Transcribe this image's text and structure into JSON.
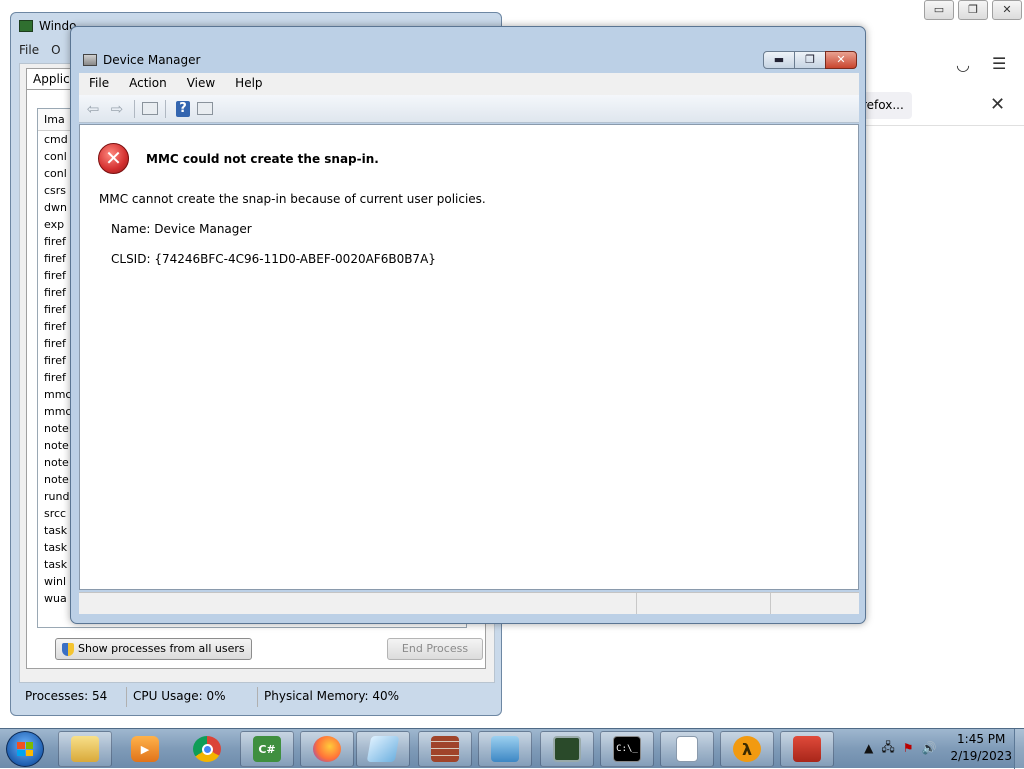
{
  "firefox": {
    "tab_label": "refox...",
    "controls": [
      "▭",
      "❐",
      "✕"
    ]
  },
  "task_manager": {
    "title": "Windows Task Manager",
    "title_visible": "Windo",
    "menu": [
      "File",
      "O"
    ],
    "tab": "Applicat",
    "list_header": "Ima",
    "processes": [
      "cmd",
      "conl",
      "conl",
      "csrs",
      "dwn",
      "exp",
      "firef",
      "firef",
      "firef",
      "firef",
      "firef",
      "firef",
      "firef",
      "firef",
      "firef",
      "mmc",
      "mmc",
      "note",
      "note",
      "note",
      "note",
      "rund",
      "srcc",
      "task",
      "task",
      "task",
      "winl",
      "wua"
    ],
    "show_all_button": "Show processes from all users",
    "end_process_button": "End Process",
    "status": {
      "processes": "Processes: 54",
      "cpu": "CPU Usage: 0%",
      "memory": "Physical Memory: 40%"
    }
  },
  "device_manager": {
    "title": "Device Manager",
    "caption": {
      "minimize": "▬",
      "maximize": "❐",
      "close": "✕"
    },
    "menu": {
      "file": "File",
      "action": "Action",
      "view": "View",
      "help": "Help"
    },
    "error": {
      "heading": "MMC could not create the snap-in.",
      "message": "MMC cannot create the snap-in because of current user policies.",
      "name_line": "Name: Device Manager",
      "clsid_line": "CLSID: {74246BFC-4C96-11D0-ABEF-0020AF6B0B7A}"
    }
  },
  "taskbar": {
    "apps": [
      "windows-explorer",
      "media-player",
      "chrome",
      "csharp",
      "firefox",
      "notepad-app",
      "firewall",
      "control-panel",
      "task-manager",
      "command-prompt",
      "blank-document",
      "half-life",
      "toolbox"
    ],
    "csharp_label": "C#",
    "cmd_label": "C:\\_",
    "clock": {
      "time": "1:45 PM",
      "date": "2/19/2023"
    }
  }
}
